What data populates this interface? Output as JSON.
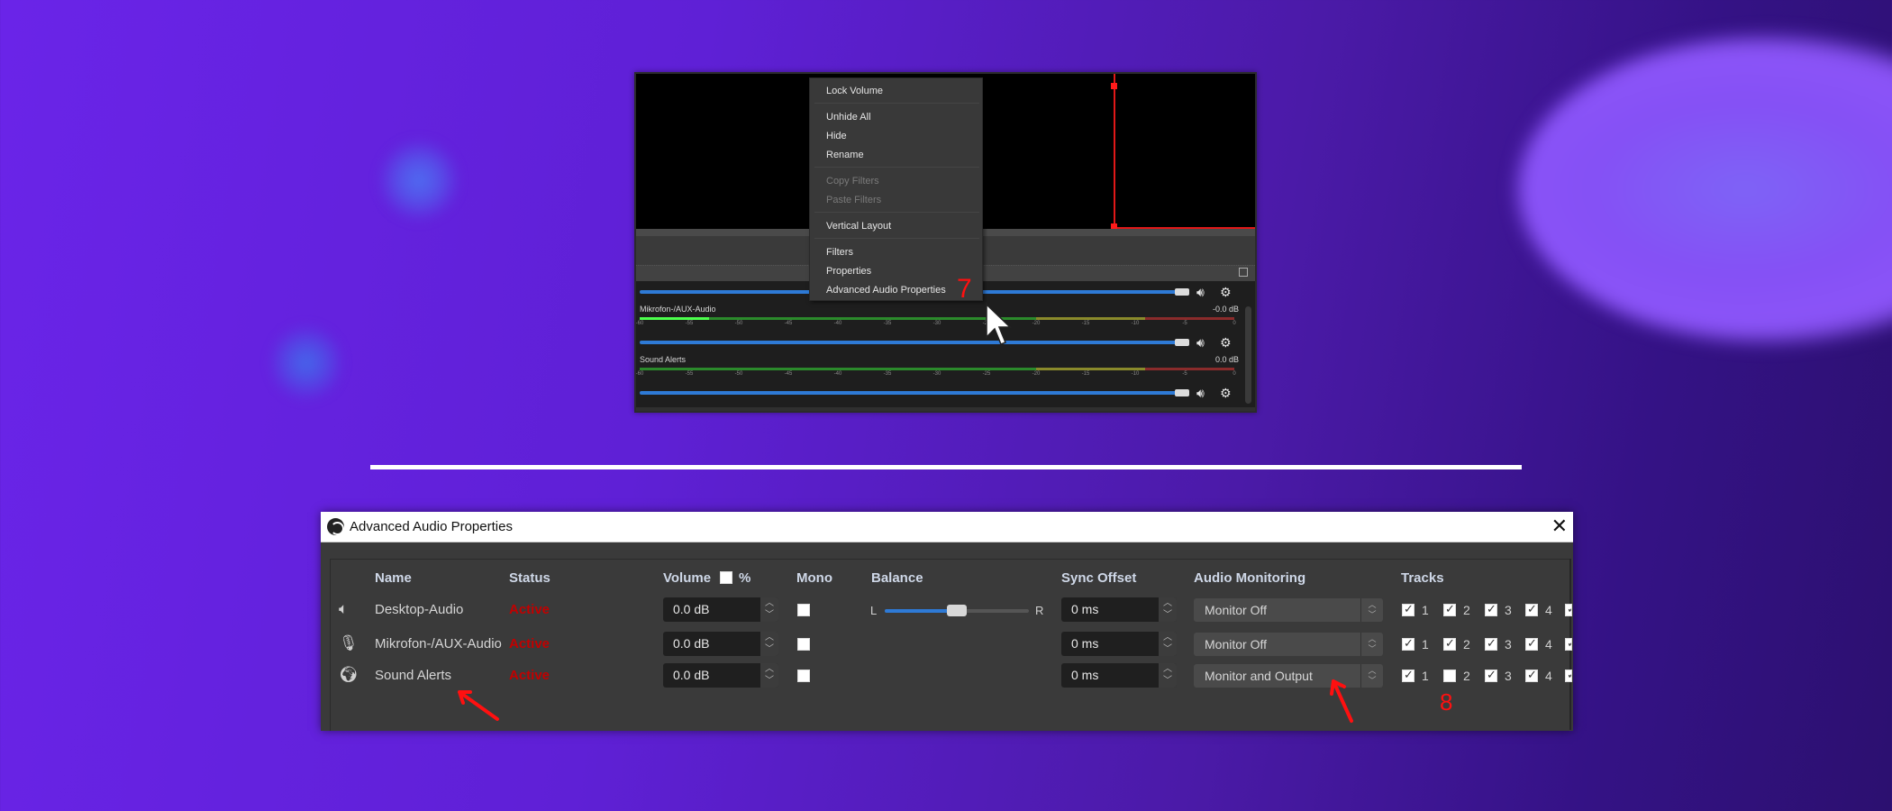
{
  "colors": {
    "accent_blue": "#2e7ad6",
    "status_active": "#c20000",
    "annotation_red": "#ff1010",
    "selection_red": "#e01818"
  },
  "context_menu": {
    "items": [
      {
        "label": "Lock Volume",
        "enabled": true
      },
      {
        "label": "Unhide All",
        "enabled": true
      },
      {
        "label": "Hide",
        "enabled": true
      },
      {
        "label": "Rename",
        "enabled": true
      },
      {
        "label": "Copy Filters",
        "enabled": false
      },
      {
        "label": "Paste Filters",
        "enabled": false
      },
      {
        "label": "Vertical Layout",
        "enabled": true
      },
      {
        "label": "Filters",
        "enabled": true
      },
      {
        "label": "Properties",
        "enabled": true
      },
      {
        "label": "Advanced Audio Properties",
        "enabled": true
      }
    ]
  },
  "annotations": {
    "step7": "7",
    "step8": "8"
  },
  "mixer": {
    "channels": [
      {
        "name": "Mikrofon-/AUX-Audio",
        "db": "-0.0 dB",
        "level_db": -53
      },
      {
        "name": "Sound Alerts",
        "db": "0.0 dB",
        "level_db": -60
      }
    ],
    "ticks": [
      "-60",
      "-55",
      "-50",
      "-45",
      "-40",
      "-35",
      "-30",
      "-25",
      "-20",
      "-15",
      "-10",
      "-5",
      "0"
    ],
    "icons": {
      "speaker": "speaker-icon",
      "gear": "gear-icon"
    }
  },
  "dialog": {
    "title": "Advanced Audio Properties",
    "close_label": "✕",
    "headers": {
      "name": "Name",
      "status": "Status",
      "volume": "Volume",
      "volume_pct": "%",
      "mono": "Mono",
      "balance": "Balance",
      "sync": "Sync Offset",
      "monitoring": "Audio Monitoring",
      "tracks": "Tracks"
    },
    "volume_percent_checked": false,
    "balance_left": "L",
    "balance_right": "R",
    "rows": [
      {
        "icon": "speaker-icon",
        "name": "Desktop-Audio",
        "status": "Active",
        "volume": "0.0 dB",
        "mono": false,
        "balance": 0.5,
        "sync": "0 ms",
        "monitoring": "Monitor Off",
        "tracks": [
          true,
          true,
          true,
          true,
          true
        ]
      },
      {
        "icon": "microphone-icon",
        "name": "Mikrofon-/AUX-Audio",
        "status": "Active",
        "volume": "0.0 dB",
        "mono": false,
        "sync": "0 ms",
        "monitoring": "Monitor Off",
        "tracks": [
          true,
          true,
          true,
          true,
          true
        ]
      },
      {
        "icon": "globe-icon",
        "name": "Sound Alerts",
        "status": "Active",
        "volume": "0.0 dB",
        "mono": false,
        "sync": "0 ms",
        "monitoring": "Monitor and Output",
        "tracks": [
          true,
          false,
          true,
          true,
          true
        ]
      }
    ],
    "track_labels": [
      "1",
      "2",
      "3",
      "4"
    ]
  }
}
